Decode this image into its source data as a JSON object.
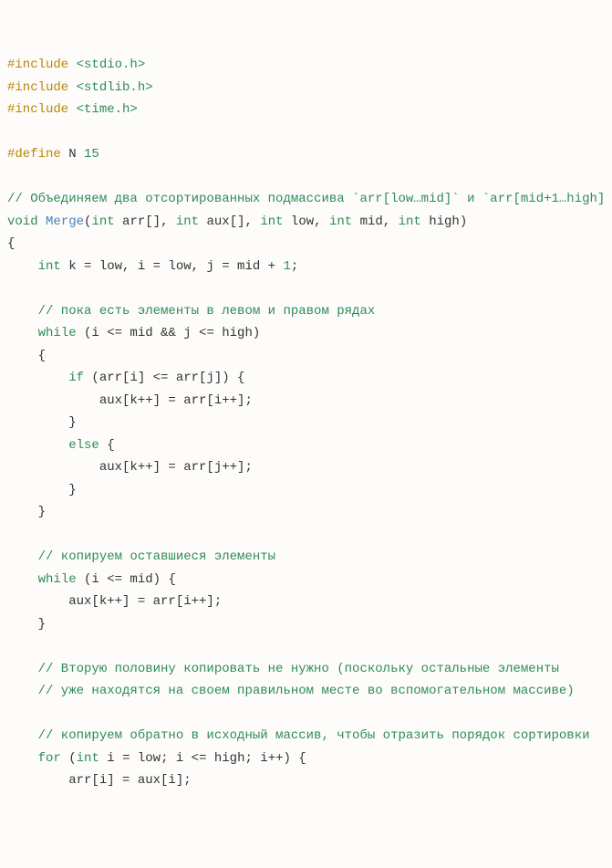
{
  "code": {
    "l1_pre": "#include",
    "l1_hdr": " <stdio.h>",
    "l2_pre": "#include",
    "l2_hdr": " <stdlib.h>",
    "l3_pre": "#include",
    "l3_hdr": " <time.h>",
    "l5_pre": "#define",
    "l5_rest": " N ",
    "l5_num": "15",
    "l7_cmt": "// Объединяем два отсортированных подмассива `arr[low…mid]` и `arr[mid+1…high]",
    "l8_kw1": "void",
    "l8_sp1": " ",
    "l8_fn": "Merge",
    "l8_p1": "(",
    "l8_kw2": "int",
    "l8_t1": " arr[], ",
    "l8_kw3": "int",
    "l8_t2": " aux[], ",
    "l8_kw4": "int",
    "l8_t3": " low, ",
    "l8_kw5": "int",
    "l8_t4": " mid, ",
    "l8_kw6": "int",
    "l8_t5": " high)",
    "l9": "{",
    "l10_i": "    ",
    "l10_kw": "int",
    "l10_t": " k = low, i = low, j = mid + ",
    "l10_n": "1",
    "l10_s": ";",
    "l12_cmt": "    // пока есть элементы в левом и правом рядах",
    "l13_i": "    ",
    "l13_kw": "while",
    "l13_t": " (i <= mid && j <= high)",
    "l14": "    {",
    "l15_i": "        ",
    "l15_kw": "if",
    "l15_t": " (arr[i] <= arr[j]) {",
    "l16": "            aux[k++] = arr[i++];",
    "l17": "        }",
    "l18_i": "        ",
    "l18_kw": "else",
    "l18_t": " {",
    "l19": "            aux[k++] = arr[j++];",
    "l20": "        }",
    "l21": "    }",
    "l23_cmt": "    // копируем оставшиеся элементы",
    "l24_i": "    ",
    "l24_kw": "while",
    "l24_t": " (i <= mid) {",
    "l25": "        aux[k++] = arr[i++];",
    "l26": "    }",
    "l28_cmt": "    // Вторую половину копировать не нужно (поскольку остальные элементы",
    "l29_cmt": "    // уже находятся на своем правильном месте во вспомогательном массиве)",
    "l31_cmt": "    // копируем обратно в исходный массив, чтобы отразить порядок сортировки",
    "l32_i": "    ",
    "l32_kw1": "for",
    "l32_t1": " (",
    "l32_kw2": "int",
    "l32_t2": " i = low; i <= high; i++) {",
    "l33": "        arr[i] = aux[i];"
  }
}
